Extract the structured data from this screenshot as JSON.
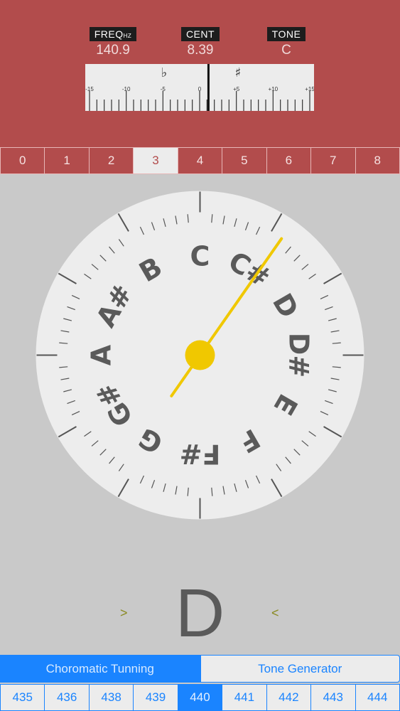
{
  "readouts": {
    "freq": {
      "label": "FREQ",
      "unit": "HZ",
      "value": "140.9"
    },
    "cent": {
      "label": "CENT",
      "value": "8.39"
    },
    "tone": {
      "label": "TONE",
      "value": "C"
    }
  },
  "cent_scale": {
    "flat_symbol": "♭",
    "sharp_symbol": "♯",
    "tick_labels": [
      "-15",
      "-10",
      "-5",
      "0",
      "+5",
      "+10",
      "+15"
    ],
    "needle_cents": 1.2
  },
  "octaves": {
    "items": [
      "0",
      "1",
      "2",
      "3",
      "4",
      "5",
      "6",
      "7",
      "8"
    ],
    "selected": "3"
  },
  "dial": {
    "notes": [
      "C",
      "C#",
      "D",
      "D#",
      "E",
      "F",
      "F#",
      "G",
      "G#",
      "A",
      "A#",
      "B"
    ],
    "needle_angle_deg": 35,
    "face_color": "#ededed",
    "needle_color": "#f0c800"
  },
  "detected_note": "D",
  "arrows": {
    "left": ">",
    "right": "<"
  },
  "modes": {
    "items": [
      "Choromatic Tunning",
      "Tone Generator"
    ],
    "selected": "Choromatic Tunning"
  },
  "pitch": {
    "items": [
      "435",
      "436",
      "438",
      "439",
      "440",
      "441",
      "442",
      "443",
      "444"
    ],
    "selected": "440"
  },
  "colors": {
    "top_panel": "#b24c4c",
    "accent": "#1a84ff",
    "background": "#c9c9c9"
  }
}
